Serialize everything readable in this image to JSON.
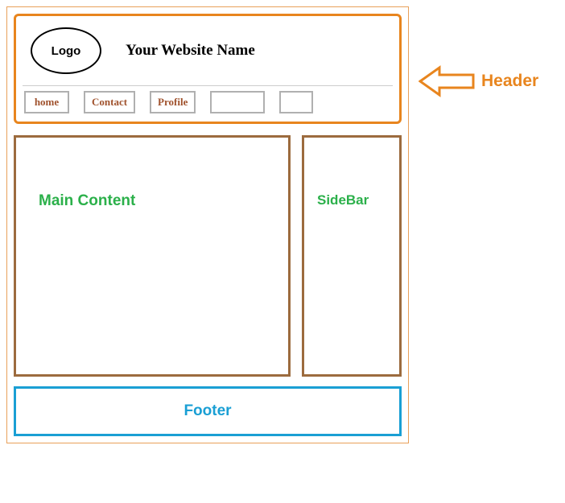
{
  "header": {
    "logo_text": "Logo",
    "site_name": "Your Website Name",
    "nav": {
      "items": [
        {
          "label": "home"
        },
        {
          "label": "Contact"
        },
        {
          "label": "Profile"
        },
        {
          "label": ""
        },
        {
          "label": ""
        }
      ]
    }
  },
  "main": {
    "label": "Main Content"
  },
  "sidebar": {
    "label": "SideBar"
  },
  "footer": {
    "label": "Footer"
  },
  "annotation": {
    "header_label": "Header"
  },
  "colors": {
    "header_border": "#e8851e",
    "nav_text": "#a0522d",
    "section_border": "#9c6b3e",
    "section_text": "#2bb04a",
    "footer": "#1a9fd4"
  }
}
